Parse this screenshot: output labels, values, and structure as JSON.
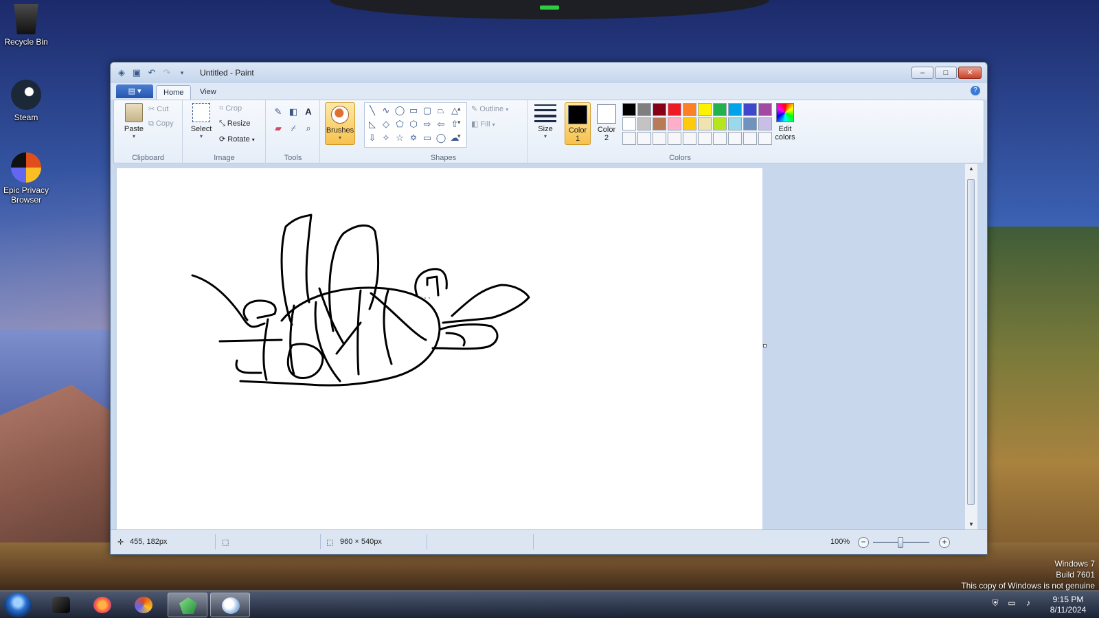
{
  "desktop": {
    "icons": [
      {
        "label": "Recycle Bin",
        "icon": "recycle-bin-icon"
      },
      {
        "label": "Steam",
        "icon": "steam-icon"
      },
      {
        "label": "Epic Privacy Browser",
        "icon": "epic-browser-icon"
      }
    ],
    "watermark": {
      "line1": "Windows 7",
      "line2": "Build 7601",
      "line3": "This copy of Windows is not genuine"
    }
  },
  "window": {
    "title": "Untitled - Paint",
    "controls": {
      "minimize": "–",
      "maximize": "□",
      "close": "✕"
    }
  },
  "ribbon": {
    "tabs": [
      {
        "label": "Home",
        "active": true
      },
      {
        "label": "View",
        "active": false
      }
    ],
    "clipboard": {
      "group_label": "Clipboard",
      "paste": "Paste",
      "cut": "Cut",
      "copy": "Copy"
    },
    "image": {
      "group_label": "Image",
      "select": "Select",
      "crop": "Crop",
      "resize": "Resize",
      "rotate": "Rotate"
    },
    "tools": {
      "group_label": "Tools"
    },
    "brushes": {
      "label": "Brushes"
    },
    "shapes": {
      "group_label": "Shapes",
      "outline": "Outline",
      "fill": "Fill"
    },
    "size": {
      "label": "Size"
    },
    "colors": {
      "group_label": "Colors",
      "color1": {
        "label1": "Color",
        "label2": "1",
        "value": "#000000"
      },
      "color2": {
        "label1": "Color",
        "label2": "2",
        "value": "#ffffff"
      },
      "edit": {
        "label1": "Edit",
        "label2": "colors"
      },
      "palette": [
        "#000000",
        "#7f7f7f",
        "#880015",
        "#ed1c24",
        "#ff7f27",
        "#fff200",
        "#22b14c",
        "#00a2e8",
        "#3f48cc",
        "#a349a4",
        "#ffffff",
        "#c3c3c3",
        "#b97a57",
        "#ffaec9",
        "#ffc90e",
        "#efe4b0",
        "#b5e61d",
        "#99d9ea",
        "#7092be",
        "#c8bfe7",
        "#f5f7fa",
        "#f5f7fa",
        "#f5f7fa",
        "#f5f7fa",
        "#f5f7fa",
        "#f5f7fa",
        "#f5f7fa",
        "#f5f7fa",
        "#f5f7fa",
        "#f5f7fa"
      ]
    }
  },
  "status": {
    "cursor_pos": "455, 182px",
    "canvas_size": "960 × 540px",
    "zoom": "100%"
  },
  "taskbar": {
    "time": "9:15 PM",
    "date": "8/11/2024",
    "apps": [
      "black-box-app-icon",
      "firefox-icon",
      "browser-icon",
      "green-gem-icon",
      "paint-icon"
    ]
  }
}
